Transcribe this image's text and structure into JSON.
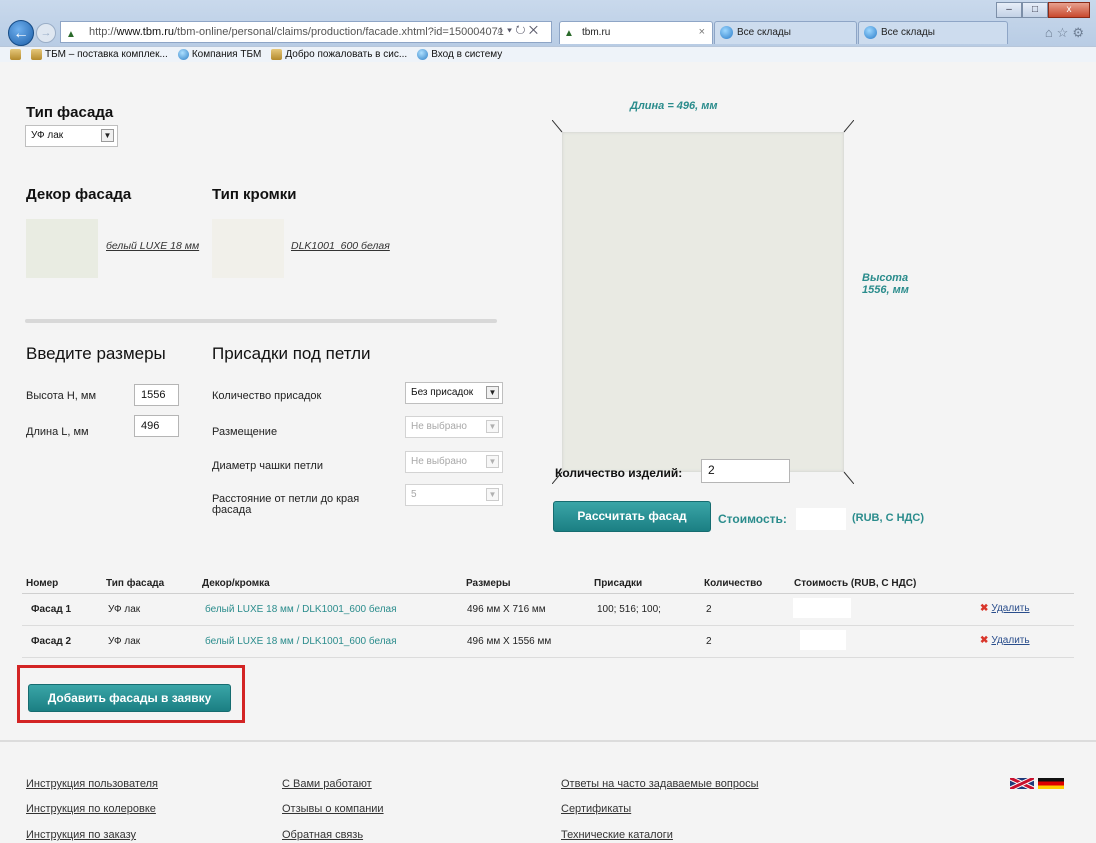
{
  "browser": {
    "url_prefix": "http://",
    "url_host": "www.tbm.ru",
    "url_path": "/tbm-online/personal/claims/production/facade.xhtml?id=150004071",
    "addr_icons": "⌕ ▾ ↻ ✕",
    "tabs": [
      {
        "label": "tbm.ru",
        "close": "×"
      },
      {
        "label": "Все склады"
      },
      {
        "label": "Все склады"
      }
    ],
    "window_controls": [
      "–",
      "□",
      "x"
    ],
    "right_icons": "⌂☆⚙",
    "favorites": [
      "ТБМ – поставка комплек...",
      "Компания ТБМ",
      "Добро пожаловать в сис...",
      "Вход в систему"
    ]
  },
  "form": {
    "facade_type_title": "Тип фасада",
    "facade_type_value": "УФ лак",
    "decor_title": "Декор фасада",
    "decor_link": "белый LUXE 18 мм",
    "edge_title": "Тип кромки",
    "edge_link": "DLK1001_600 белая",
    "sizes_title": "Введите размеры",
    "height_label": "Высота H, мм",
    "height_value": "1556",
    "length_label": "Длина L, мм",
    "length_value": "496",
    "hinges_title": "Присадки под петли",
    "hinge_count_label": "Количество присадок",
    "hinge_count_value": "Без присадок",
    "placement_label": "Размещение",
    "placement_value": "Не выбрано",
    "cup_diameter_label": "Диаметр чашки петли",
    "cup_diameter_value": "Не выбрано",
    "edge_distance_label": "Расстояние от петли до края фасада",
    "edge_distance_value": "5"
  },
  "preview": {
    "length_text": "Длина = 496, мм",
    "height_text_1": "Высота",
    "height_text_2": "1556, мм"
  },
  "calc": {
    "qty_label": "Количество изделий:",
    "qty_value": "2",
    "calc_button": "Рассчитать фасад",
    "cost_label": "Стоимость:",
    "cost_unit": "(RUB, С НДС)"
  },
  "table": {
    "headers": [
      "Номер",
      "Тип фасада",
      "Декор/кромка",
      "Размеры",
      "Присадки",
      "Количество",
      "Стоимость (RUB, С НДС)"
    ],
    "rows": [
      {
        "number": "Фасад 1",
        "type": "УФ лак",
        "decor": "белый LUXE 18 мм / DLK1001_600 белая",
        "size": "496 мм X 716 мм",
        "holes": "100; 516; 100;",
        "qty": "2",
        "delete": "Удалить"
      },
      {
        "number": "Фасад 2",
        "type": "УФ лак",
        "decor": "белый LUXE 18 мм / DLK1001_600 белая",
        "size": "496 мм X 1556 мм",
        "holes": "",
        "qty": "2",
        "delete": "Удалить"
      }
    ],
    "delete_icon": "✖"
  },
  "add_button": "Добавить фасады в заявку",
  "footer": {
    "col1": [
      "Инструкция пользователя",
      "Инструкция по колеровке",
      "Инструкция по заказу"
    ],
    "col2": [
      "С Вами работают",
      "Отзывы о компании",
      "Обратная связь"
    ],
    "col3": [
      "Ответы на часто задаваемые вопросы",
      "Сертификаты",
      "Технические каталоги"
    ]
  },
  "colors": {
    "accent": "#1b7f83",
    "accent_text": "#2a8c8c",
    "highlight": "#d32424",
    "delete_icon": "#d9362b"
  }
}
